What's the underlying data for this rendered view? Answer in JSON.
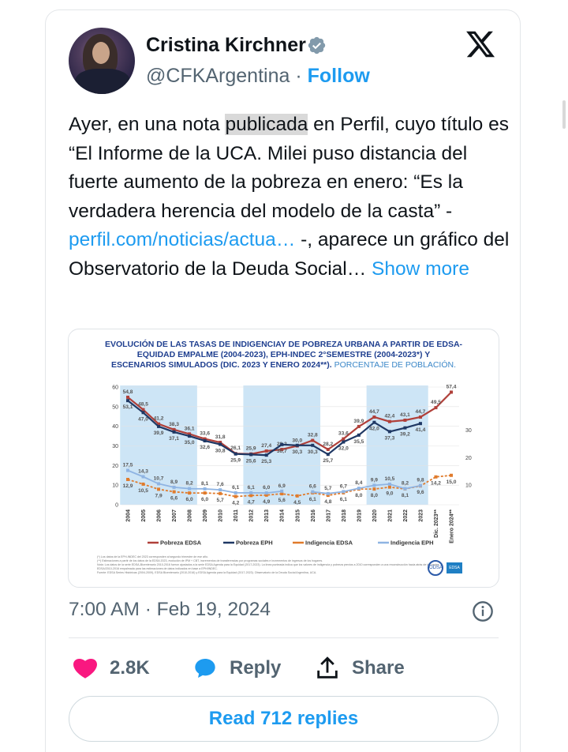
{
  "user": {
    "name": "Cristina Kirchner",
    "handle": "@CFKArgentina",
    "separator": "·",
    "follow_label": "Follow"
  },
  "tweet": {
    "text_part1": "Ayer, en una nota ",
    "highlighted": "publicada",
    "text_part2": " en Perfil, cuyo título es “El Informe de la UCA. Milei puso distancia del fuerte aumento de la pobreza en enero: “Es la verdadera herencia del modelo de la casta” - ",
    "link": "perfil.com/noticias/actua…",
    "text_part3": " -, aparece un gráfico del Observatorio de la Deuda Social…",
    "show_more": "Show more"
  },
  "meta": {
    "timestamp": "7:00 AM · Feb 19, 2024"
  },
  "actions": {
    "likes": "2.8K",
    "reply_label": "Reply",
    "share_label": "Share",
    "read_replies": "Read 712 replies"
  },
  "colors": {
    "accent": "#1d9bf0",
    "like": "#f91880",
    "pobreza_edsa": "#b0403a",
    "pobreza_eph": "#1f3864",
    "indigencia_edsa": "#e07b2c",
    "indigencia_eph": "#8fb4e3",
    "shade": "#bcdcf3"
  },
  "icons": [
    "verified-badge-icon",
    "x-logo-icon",
    "info-icon",
    "heart-icon",
    "reply-bubble-icon",
    "share-icon"
  ],
  "chart_data": {
    "type": "line",
    "title_line1": "EVOLUCIÓN DE LAS TASAS DE INDIGENCIAY DE POBREZA URBANA A PARTIR DE EDSA-",
    "title_line2": "EQUIDAD EMPALME (2004-2023), EPH-INDEC 2°SEMESTRE (2004-2023*) Y",
    "title_line3": "ESCENARIOS SIMULADOS (DIC. 2023 Y ENERO 2024**).",
    "title_sub": " PORCENTAJE DE POBLACIÓN.",
    "categories": [
      "2004",
      "2005",
      "2006",
      "2007",
      "2008",
      "2009",
      "2010",
      "2011",
      "2012",
      "2013",
      "2014",
      "2015",
      "2016",
      "2017",
      "2018",
      "2019",
      "2020",
      "2021",
      "2022",
      "2023",
      "Dic. 2023**",
      "Enero 2024**"
    ],
    "ylim_left": [
      0,
      60
    ],
    "yticks_left": [
      0,
      10,
      20,
      30,
      40,
      50,
      60
    ],
    "yticks_right": [
      10,
      20,
      30
    ],
    "shaded_ranges": [
      [
        0,
        4
      ],
      [
        8,
        12
      ],
      [
        16,
        19
      ]
    ],
    "series": [
      {
        "name": "Pobreza EDSA",
        "values": [
          54.8,
          48.5,
          41.2,
          38.3,
          36.1,
          33.6,
          31.8,
          26.1,
          25.9,
          27.4,
          28.2,
          30.0,
          32.8,
          28.2,
          33.6,
          39.9,
          44.7,
          42.4,
          43.1,
          44.7,
          49.5,
          57.4
        ]
      },
      {
        "name": "Pobreza EPH",
        "values": [
          53.1,
          47.0,
          39.9,
          37.1,
          35.0,
          32.6,
          30.8,
          25.9,
          25.6,
          25.3,
          30.7,
          30.3,
          30.3,
          25.7,
          32.0,
          35.5,
          42.0,
          37.3,
          39.2,
          41.4,
          null,
          null
        ]
      },
      {
        "name": "Indigencia EDSA",
        "values": [
          12.9,
          10.5,
          7.9,
          6.6,
          6.0,
          6.0,
          5.7,
          4.2,
          4.7,
          4.9,
          5.6,
          4.5,
          6.1,
          4.8,
          6.1,
          8.0,
          8.0,
          9.0,
          8.1,
          9.6,
          14.2,
          15.0
        ]
      },
      {
        "name": "Indigencia EPH",
        "values": [
          17.5,
          14.3,
          10.7,
          8.9,
          8.2,
          8.1,
          7.6,
          6.1,
          6.1,
          6.0,
          6.9,
          null,
          6.6,
          5.7,
          6.7,
          8.4,
          9.9,
          10.5,
          8.2,
          9.8,
          null,
          null
        ]
      }
    ],
    "notes": [
      "(*) Los datos de la EPH-INDEC del 2023 corresponden al segundo trimestre de ese año.",
      "(**) Estimaciones a partir de los datos de la EDSA 2023, evolución de IPM + CBT, incrementos de transferencias por programas sociales e incrementos de ingresos de los hogares.",
      "Nota: Los datos de la serie EDSA-Bicentenario 2010-2016 fueron ajustados a la serie EDSA Agenda para la Equidad (2017-2023). La línea punteada indica que los valores de indigencia y pobreza previos a 2010 corresponden a una reconstrucción hacia atrás de las series EDSA/2010-2016 empalmada para las estimaciones de datos indicados en base a EPH/INDEC.",
      "Fuente: EDSA Series Históricas (2004-2009), EDSA Bicentenario (2010-2016) y EDSA Agenda para la Equidad (2017-2023). Observatorio de la Deuda Social Argentina, UCA."
    ]
  }
}
